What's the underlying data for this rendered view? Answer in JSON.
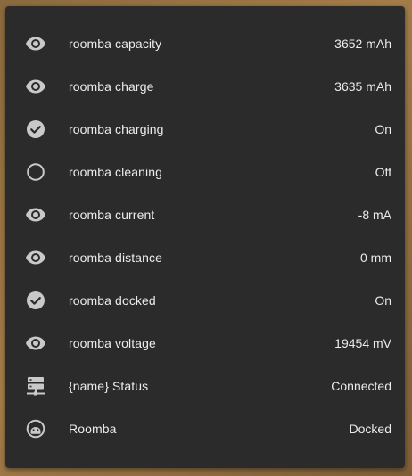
{
  "entities": [
    {
      "icon": "eye-icon",
      "label": "roomba capacity",
      "value": "3652 mAh"
    },
    {
      "icon": "eye-icon",
      "label": "roomba charge",
      "value": "3635 mAh"
    },
    {
      "icon": "check-circle-icon",
      "label": "roomba charging",
      "value": "On"
    },
    {
      "icon": "circle-outline-icon",
      "label": "roomba cleaning",
      "value": "Off"
    },
    {
      "icon": "eye-icon",
      "label": "roomba current",
      "value": "-8 mA"
    },
    {
      "icon": "eye-icon",
      "label": "roomba distance",
      "value": "0 mm"
    },
    {
      "icon": "check-circle-icon",
      "label": "roomba docked",
      "value": "On"
    },
    {
      "icon": "eye-icon",
      "label": "roomba voltage",
      "value": "19454 mV"
    },
    {
      "icon": "server-network-icon",
      "label": "{name} Status",
      "value": "Connected"
    },
    {
      "icon": "robot-vacuum-icon",
      "label": "Roomba",
      "value": "Docked"
    }
  ],
  "colors": {
    "card": "#2b2b2c",
    "icon": "#c9c9c9",
    "text": "#ececec"
  }
}
